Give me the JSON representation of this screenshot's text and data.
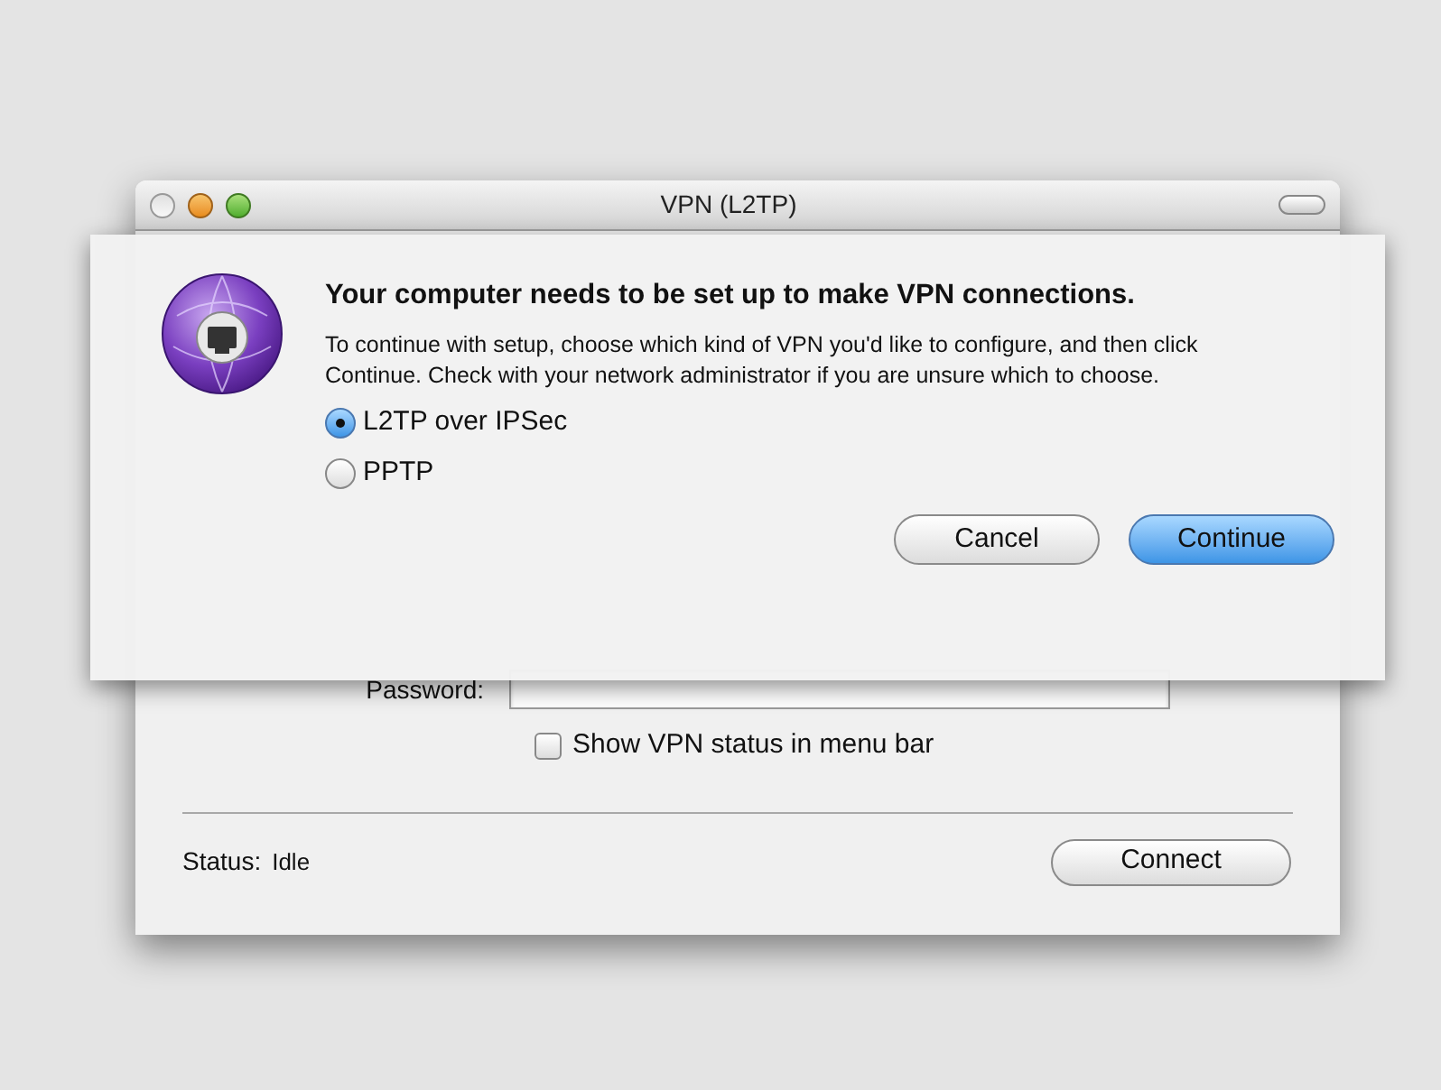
{
  "window": {
    "title": "VPN (L2TP)"
  },
  "form": {
    "password_label": "Password:",
    "show_status": {
      "label": "Show VPN status in menu bar",
      "checked": false
    }
  },
  "status": {
    "label": "Status:",
    "value": "Idle"
  },
  "connect_button": "Connect",
  "sheet": {
    "heading": "Your computer needs to be set up to make VPN connections.",
    "message": "To continue with setup, choose which kind of VPN you'd like to configure, and then click Continue. Check with your network administrator if you are unsure which to choose.",
    "options": [
      {
        "label": "L2TP over IPSec",
        "selected": true
      },
      {
        "label": "PPTP",
        "selected": false
      }
    ],
    "buttons": [
      {
        "label": "Cancel",
        "kind": "normal"
      },
      {
        "label": "Continue",
        "kind": "default"
      }
    ]
  }
}
